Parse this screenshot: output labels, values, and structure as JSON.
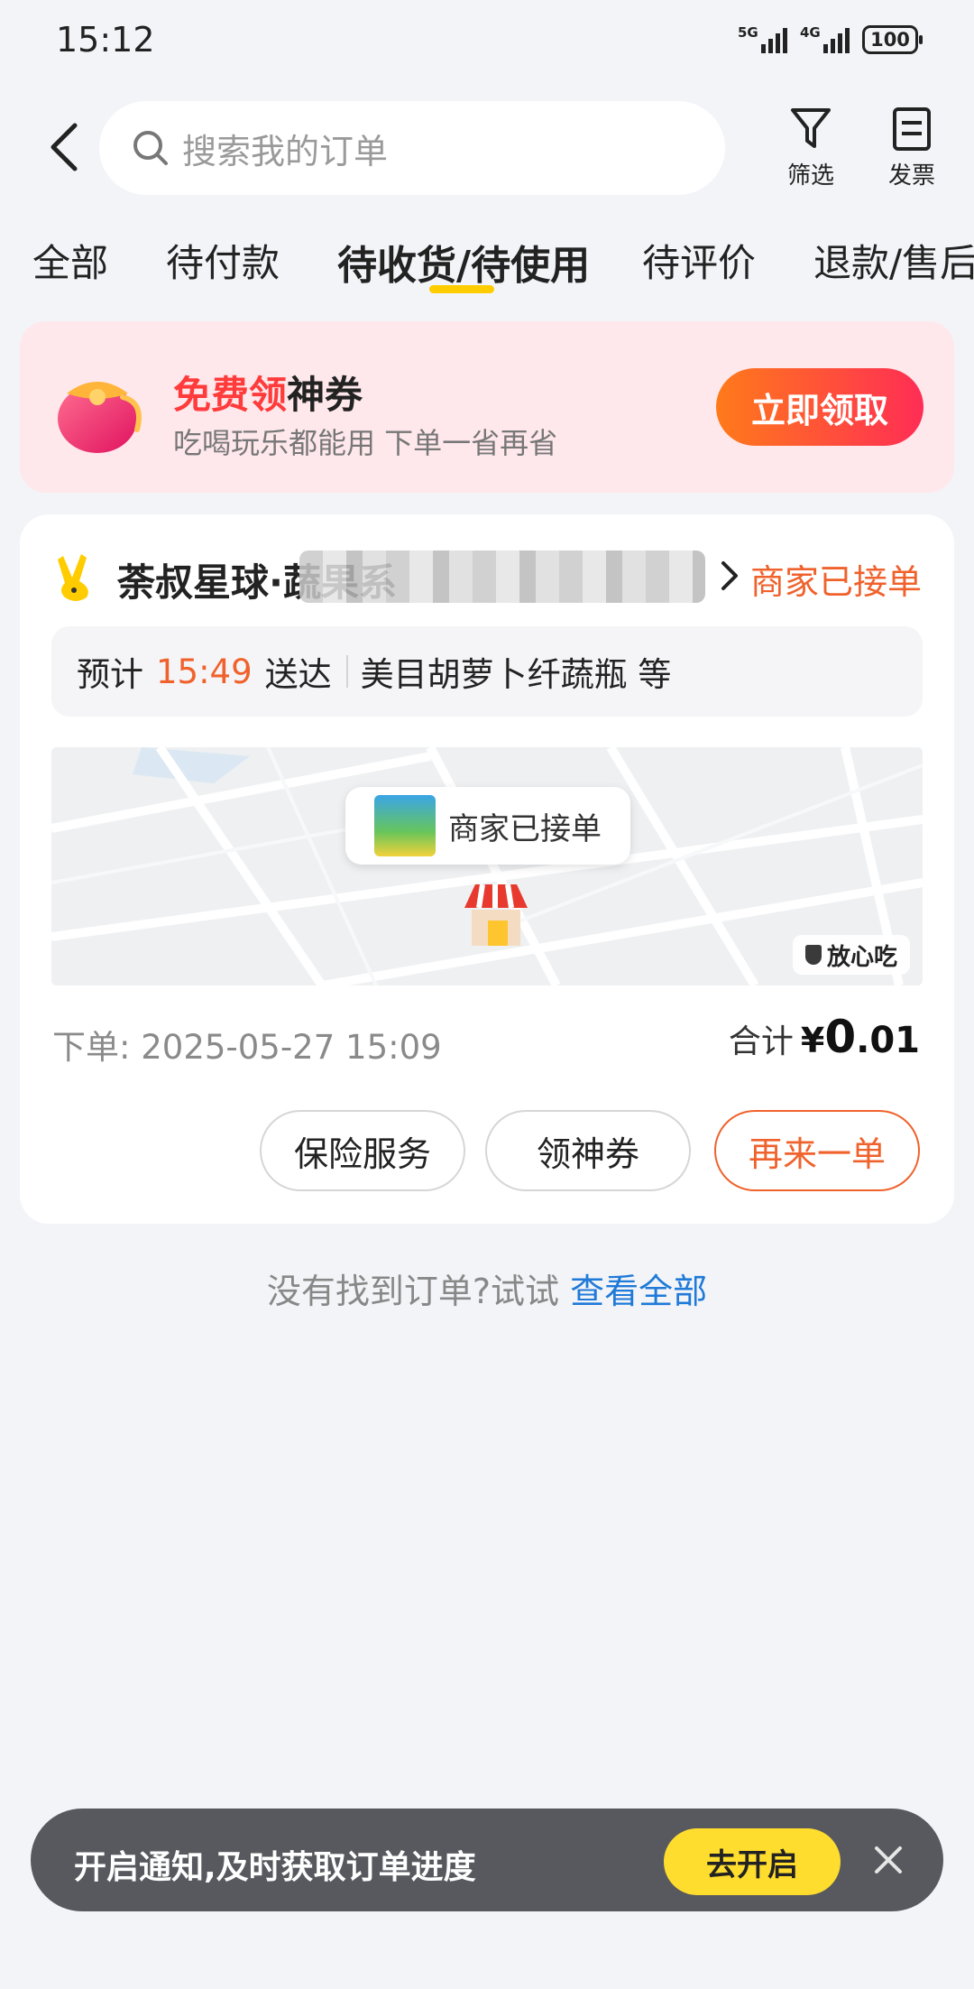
{
  "status_bar": {
    "time": "15:12",
    "net1": "5G",
    "net2": "4G",
    "battery": "100"
  },
  "header": {
    "search_placeholder": "搜索我的订单",
    "filter_label": "筛选",
    "invoice_label": "发票"
  },
  "tabs": [
    {
      "label": "全部",
      "active": false
    },
    {
      "label": "待付款",
      "active": false
    },
    {
      "label": "待收货/待使用",
      "active": true
    },
    {
      "label": "待评价",
      "active": false
    },
    {
      "label": "退款/售后",
      "active": false
    }
  ],
  "promo": {
    "title_highlight": "免费领",
    "title_rest": "神券",
    "subtitle": "吃喝玩乐都能用 下单一省再省",
    "button": "立即领取"
  },
  "order": {
    "shop_name": "荼叔星球·蔬果系",
    "status": "商家已接单",
    "eta_prefix": "预计",
    "eta_time": "15:49",
    "eta_suffix": "送达",
    "items": "美目胡萝卜纤蔬瓶 等",
    "map_status": "商家已接单",
    "safe_badge": "放心吃",
    "order_time_label": "下单:",
    "order_time": "2025-05-27 15:09",
    "total_label": "合计",
    "currency": "¥",
    "total_int": "0",
    "total_dec": ".01",
    "actions": {
      "insurance": "保险服务",
      "coupon": "领神券",
      "reorder": "再来一单"
    }
  },
  "not_found": {
    "text": "没有找到订单?试试",
    "link": "查看全部"
  },
  "notice": {
    "text": "开启通知,及时获取订单进度",
    "button": "去开启"
  },
  "colors": {
    "accent_orange": "#f0622c",
    "tab_indicator": "#ffcc00",
    "link_blue": "#1f7ad8",
    "notice_yellow": "#ffdd2e"
  }
}
